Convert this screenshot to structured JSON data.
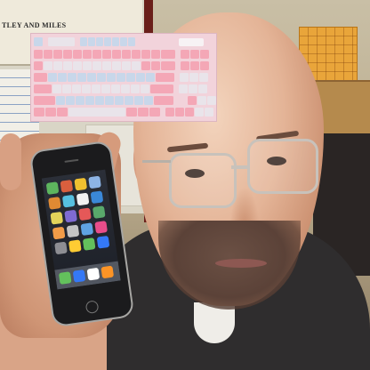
{
  "sign": {
    "text": "TLEY AND MILES"
  },
  "colors": {
    "keyboard_base": "#f2d3db",
    "key_pink": "#f4a7b6",
    "key_blue": "#c8d7ea",
    "key_light": "#e9e4ea",
    "phone_body": "#1b1b1d",
    "sweater": "#2f2d2e"
  },
  "phone": {
    "app_colors": [
      "#5db55e",
      "#d95f3e",
      "#f0c030",
      "#8db4e6",
      "#e08a33",
      "#56c0e0",
      "#f2f2f2",
      "#3a88d8",
      "#e3d35a",
      "#7f6bd3",
      "#e55858",
      "#59a86b",
      "#f29c48",
      "#c4c4c4",
      "#5fa3e3",
      "#e84d8a",
      "#8e8e93",
      "#ffcc33",
      "#63c15c",
      "#3478f6"
    ],
    "dock_colors": [
      "#63c15c",
      "#3478f6",
      "#ffffff",
      "#fd9426"
    ]
  }
}
